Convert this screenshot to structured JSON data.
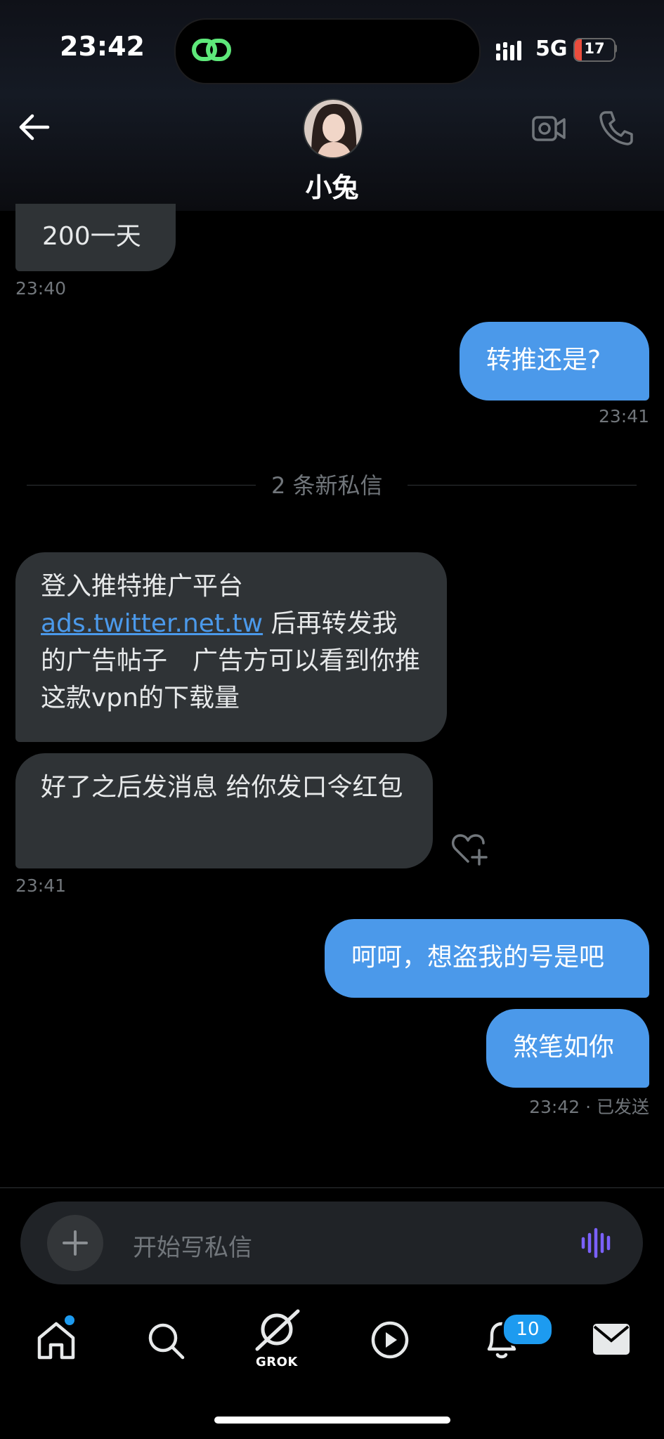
{
  "status": {
    "time": "23:42",
    "network": "5G",
    "battery": "17",
    "battery_level": 0.17
  },
  "header": {
    "contact_name": "小兔"
  },
  "messages": {
    "m1": {
      "text": "200一天",
      "time": "23:40"
    },
    "m2": {
      "text": "转推还是?",
      "time": "23:41"
    },
    "divider": "2 条新私信",
    "m3": {
      "line1": "登入推特推广平台",
      "link": "ads.twitter.net.tw",
      "rest": " 后再转发我的广告帖子　广告方可以看到你推这款vpn的下载量"
    },
    "m4": {
      "text": "好了之后发消息  给你发口令红包",
      "time": "23:41"
    },
    "m5": {
      "text": "呵呵，想盗我的号是吧"
    },
    "m6": {
      "text": "煞笔如你",
      "time": "23:42 · 已发送"
    }
  },
  "composer": {
    "placeholder": "开始写私信"
  },
  "tabs": {
    "grok_label": "GROK",
    "notifications_count": "10"
  },
  "icons": {
    "back": "arrow-left-icon",
    "video": "video-camera-icon",
    "phone": "phone-icon",
    "react": "heart-plus-icon",
    "add": "plus-icon",
    "voice": "voice-wave-icon",
    "home": "home-icon",
    "search": "search-icon",
    "grok": "grok-icon",
    "video_tab": "play-circle-icon",
    "notifications": "bell-icon",
    "messages": "mail-icon"
  },
  "colors": {
    "accent": "#1d9bf0",
    "sent_bubble": "#4b99ea",
    "received_bubble": "#2f3336",
    "battery_low": "#eb4d3d"
  }
}
